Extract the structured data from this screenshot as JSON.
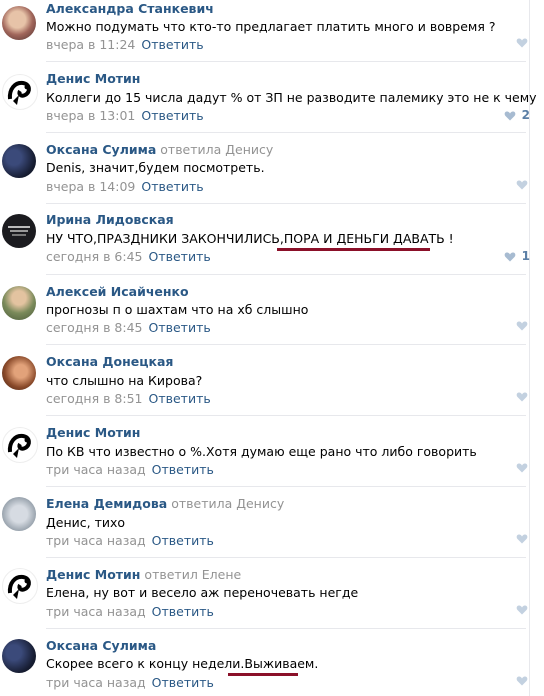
{
  "comments": [
    {
      "author": "Александра Станкевич",
      "reply_to": "",
      "text": "Можно подумать что кто-то предлагает платить много и вовремя ?",
      "time": "вчера в 11:24",
      "reply": "Ответить",
      "likes": ""
    },
    {
      "author": "Денис Мотин",
      "reply_to": "",
      "text": "Коллеги до 15 числа дадут % от ЗП не разводите палемику это не к чему",
      "time": "вчера в 13:01",
      "reply": "Ответить",
      "likes": "2"
    },
    {
      "author": "Оксана Сулима",
      "reply_to": "ответила Денису",
      "text": "Denis, значит,будем посмотреть.",
      "time": "вчера в 14:09",
      "reply": "Ответить",
      "likes": ""
    },
    {
      "author": "Ирина Лидовская",
      "reply_to": "",
      "text": "НУ ЧТО,ПРАЗДНИКИ ЗАКОНЧИЛИСЬ,ПОРА И ДЕНЬГИ ДАВАТЬ !",
      "time": "сегодня в 6:45",
      "reply": "Ответить",
      "likes": "1"
    },
    {
      "author": "Алексей Исайченко",
      "reply_to": "",
      "text": "прогнозы п о шахтам что на хб слышно",
      "time": "сегодня в 8:45",
      "reply": "Ответить",
      "likes": ""
    },
    {
      "author": "Оксана Донецкая",
      "reply_to": "",
      "text": "что слышно на Кирова?",
      "time": "сегодня в 8:51",
      "reply": "Ответить",
      "likes": ""
    },
    {
      "author": "Денис Мотин",
      "reply_to": "",
      "text": "По КВ что известно о %.Хотя думаю еще рано что либо говорить",
      "time": "три часа назад",
      "reply": "Ответить",
      "likes": ""
    },
    {
      "author": "Елена Демидова",
      "reply_to": "ответила Денису",
      "text": "Денис, тихо",
      "time": "три часа назад",
      "reply": "Ответить",
      "likes": ""
    },
    {
      "author": "Денис Мотин",
      "reply_to": "ответил Елене",
      "text": "Елена, ну вот и весело аж переночевать негде",
      "time": "три часа назад",
      "reply": "Ответить",
      "likes": ""
    },
    {
      "author": "Оксана Сулима",
      "reply_to": "",
      "text": "Скорее всего к концу недели.Выживаем.",
      "time": "три часа назад",
      "reply": "Ответить",
      "likes": ""
    }
  ],
  "colors": {
    "link": "#2a5885",
    "meta": "#939393",
    "underline": "#8b1029",
    "like": "#c3d1e0"
  }
}
